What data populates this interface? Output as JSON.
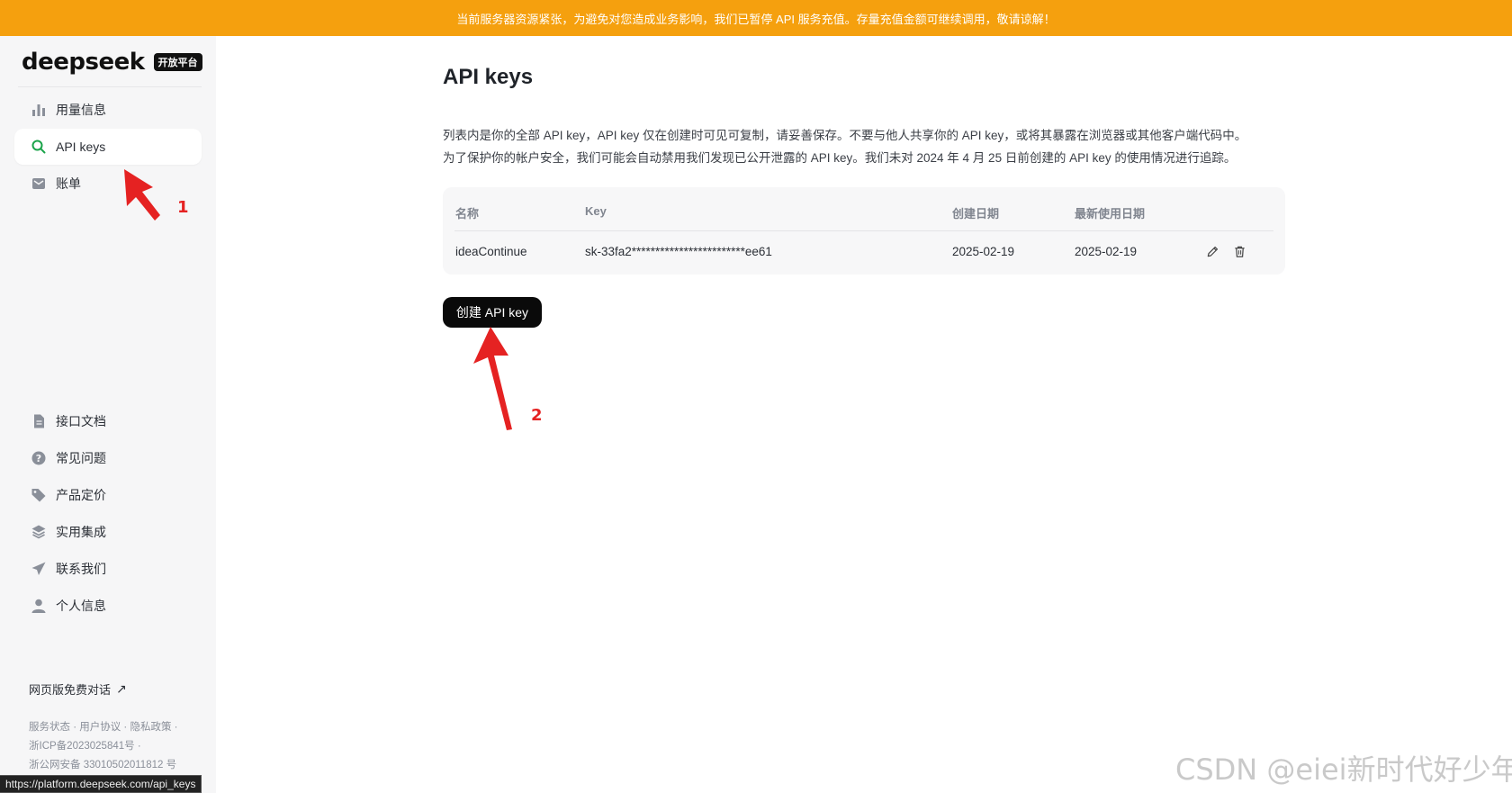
{
  "banner": {
    "text": "当前服务器资源紧张，为避免对您造成业务影响，我们已暂停 API 服务充值。存量充值金额可继续调用，敬请谅解！"
  },
  "brand": {
    "name": "deepseek",
    "badge": "开放平台"
  },
  "sidebar": {
    "top_items": [
      {
        "label": "用量信息",
        "icon": "bar-chart-icon"
      },
      {
        "label": "API keys",
        "icon": "search-icon",
        "active": true
      },
      {
        "label": "账单",
        "icon": "wallet-icon"
      }
    ],
    "bottom_items": [
      {
        "label": "接口文档",
        "icon": "document-icon"
      },
      {
        "label": "常见问题",
        "icon": "question-icon"
      },
      {
        "label": "产品定价",
        "icon": "tag-icon"
      },
      {
        "label": "实用集成",
        "icon": "layers-icon"
      },
      {
        "label": "联系我们",
        "icon": "send-icon"
      },
      {
        "label": "个人信息",
        "icon": "user-icon"
      }
    ],
    "web_chat": {
      "label": "网页版免费对话",
      "icon": "external-arrow-icon"
    },
    "footer": {
      "links": [
        "服务状态",
        "用户协议",
        "隐私政策"
      ],
      "icp": "浙ICP备2023025841号",
      "police": "浙公网安备 33010502011812 号"
    }
  },
  "status_bar": {
    "url": "https://platform.deepseek.com/api_keys"
  },
  "main": {
    "title": "API keys",
    "description_line1": "列表内是你的全部 API key，API key 仅在创建时可见可复制，请妥善保存。不要与他人共享你的 API key，或将其暴露在浏览器或其他客户端代码中。",
    "description_line2": "为了保护你的帐户安全，我们可能会自动禁用我们发现已公开泄露的 API key。我们未对 2024 年 4 月 25 日前创建的 API key 的使用情况进行追踪。",
    "table": {
      "columns": [
        "名称",
        "Key",
        "创建日期",
        "最新使用日期"
      ],
      "rows": [
        {
          "name": "ideaContinue",
          "key": "sk-33fa2************************ee61",
          "created": "2025-02-19",
          "last_used": "2025-02-19"
        }
      ]
    },
    "create_button": "创建 API key"
  },
  "annotations": {
    "one": "1",
    "two": "2",
    "arrow_color": "#e52222"
  },
  "watermark": "CSDN @eiei新时代好少年",
  "colors": {
    "banner": "#f5a00e",
    "sidebar_bg": "#f6f6f7",
    "active_icon": "#1aa34a",
    "button": "#0a0a0a"
  }
}
